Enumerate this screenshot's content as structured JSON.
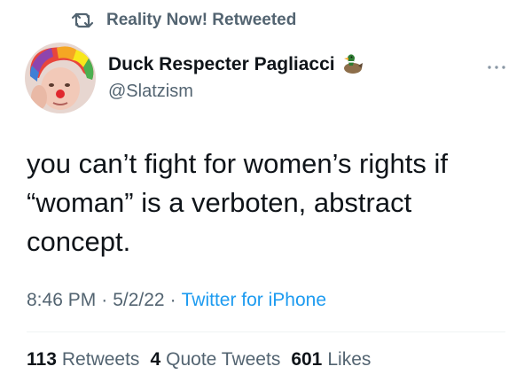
{
  "retweet_banner": {
    "text": "Reality Now! Retweeted",
    "icon": "retweet-icon"
  },
  "author": {
    "display_name": "Duck Respecter Pagliacci",
    "handle": "@Slatzism",
    "name_emoji_icon": "duck-icon",
    "avatar_icon": "avatar-rainbow-hair"
  },
  "menu_icon": "more-icon",
  "tweet": {
    "text": "you can’t fight for women’s rights if\n“woman” is a verboten, abstract\nconcept.",
    "time": "8:46 PM",
    "date": "5/2/22",
    "separator": "·",
    "source": "Twitter for iPhone"
  },
  "stats": {
    "retweets_count": "113",
    "retweets_label": "Retweets",
    "quotes_count": "4",
    "quotes_label": "Quote Tweets",
    "likes_count": "601",
    "likes_label": "Likes"
  },
  "colors": {
    "text_primary": "#0f1419",
    "text_secondary": "#536471",
    "link": "#1d9bf0",
    "divider": "#eff3f4"
  }
}
